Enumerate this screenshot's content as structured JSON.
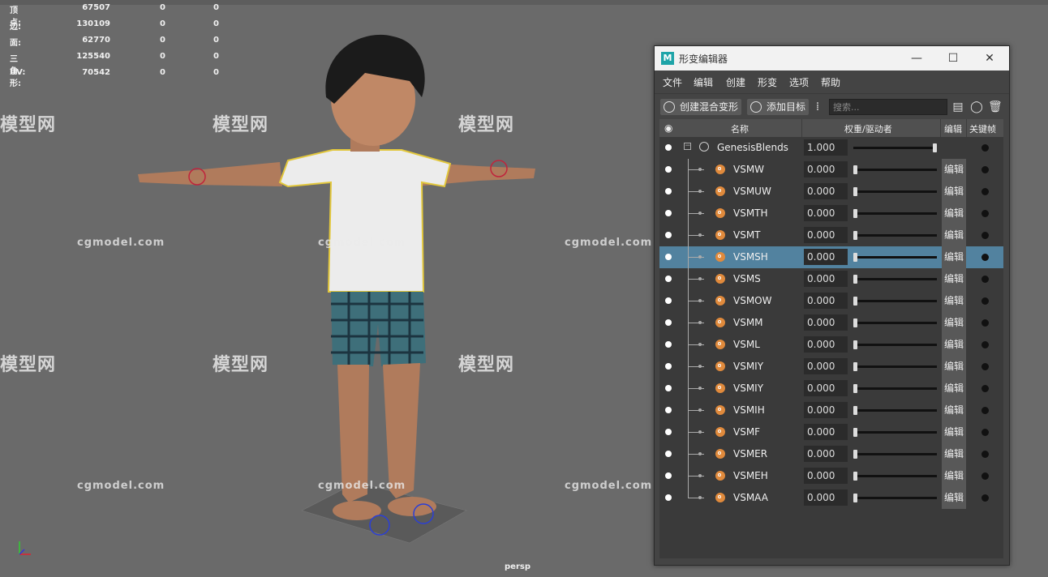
{
  "hud": {
    "rows": [
      {
        "label": "顶点:",
        "v1": "67507",
        "v2": "0",
        "v3": "0"
      },
      {
        "label": "边:",
        "v1": "130109",
        "v2": "0",
        "v3": "0"
      },
      {
        "label": "面:",
        "v1": "62770",
        "v2": "0",
        "v3": "0"
      },
      {
        "label": "三角形:",
        "v1": "125540",
        "v2": "0",
        "v3": "0"
      },
      {
        "label": "UV:",
        "v1": "70542",
        "v2": "0",
        "v3": "0"
      }
    ]
  },
  "viewport": {
    "camera": "persp"
  },
  "watermark": {
    "logo_text": "模型网",
    "site_text": "cgmodel.com"
  },
  "window": {
    "title": "形变编辑器",
    "menu": [
      "文件",
      "编辑",
      "创建",
      "形变",
      "选项",
      "帮助"
    ],
    "toolbar": {
      "create_blend": "创建混合变形",
      "add_target": "添加目标",
      "search_placeholder": "搜索..."
    },
    "columns": {
      "name": "名称",
      "weight": "权重/驱动者",
      "edit": "编辑",
      "key": "关键帧"
    },
    "group": {
      "name": "GenesisBlends",
      "value": "1.000",
      "level": 1.0
    },
    "edit_label": "编辑",
    "targets": [
      {
        "name": "VSMW",
        "value": "0.000",
        "level": 0
      },
      {
        "name": "VSMUW",
        "value": "0.000",
        "level": 0
      },
      {
        "name": "VSMTH",
        "value": "0.000",
        "level": 0
      },
      {
        "name": "VSMT",
        "value": "0.000",
        "level": 0
      },
      {
        "name": "VSMSH",
        "value": "0.000",
        "level": 0,
        "selected": true
      },
      {
        "name": "VSMS",
        "value": "0.000",
        "level": 0
      },
      {
        "name": "VSMOW",
        "value": "0.000",
        "level": 0
      },
      {
        "name": "VSMM",
        "value": "0.000",
        "level": 0
      },
      {
        "name": "VSML",
        "value": "0.000",
        "level": 0
      },
      {
        "name": "VSMIY",
        "value": "0.000",
        "level": 0
      },
      {
        "name": "VSMIY",
        "value": "0.000",
        "level": 0
      },
      {
        "name": "VSMIH",
        "value": "0.000",
        "level": 0
      },
      {
        "name": "VSMF",
        "value": "0.000",
        "level": 0
      },
      {
        "name": "VSMER",
        "value": "0.000",
        "level": 0
      },
      {
        "name": "VSMEH",
        "value": "0.000",
        "level": 0
      },
      {
        "name": "VSMAA",
        "value": "0.000",
        "level": 0
      }
    ]
  },
  "colors": {
    "selection": "#52829f",
    "target_icon": "#e08a3c",
    "viewport_bg": "#6a6a6a"
  }
}
